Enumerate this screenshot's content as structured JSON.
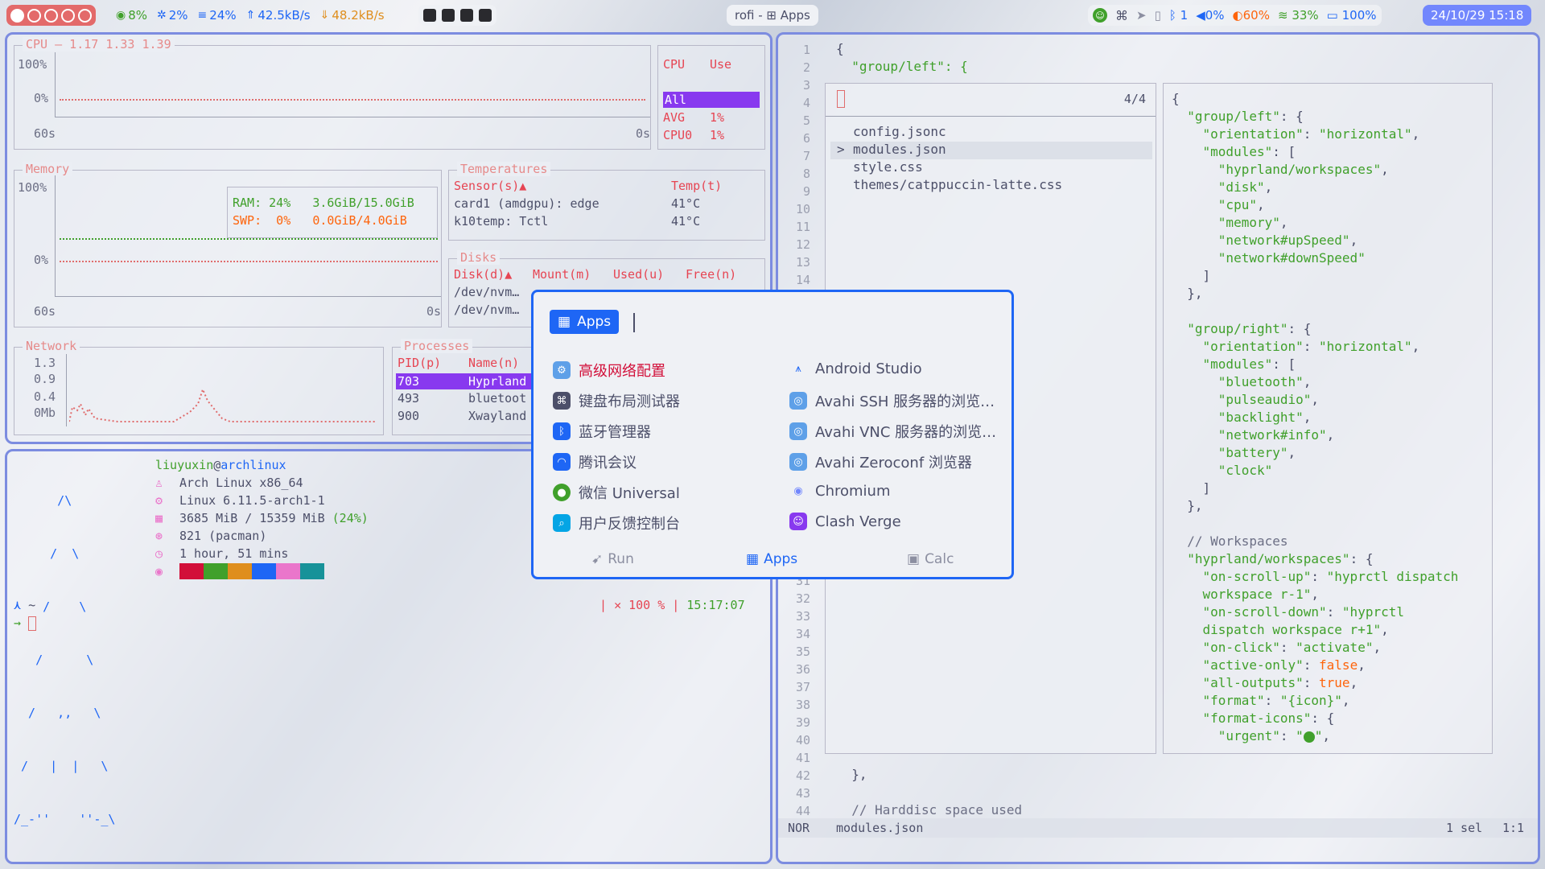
{
  "topbar": {
    "workspaces": [
      "1",
      "2",
      "3",
      "4",
      "5"
    ],
    "stats": [
      {
        "icon": "cpu-circle-icon",
        "value": "8%",
        "color": "#40a02b"
      },
      {
        "icon": "gear-icon",
        "value": "2%",
        "color": "#1e66f5"
      },
      {
        "icon": "memory-icon",
        "value": "24%",
        "color": "#1e66f5"
      },
      {
        "icon": "up-speed-icon",
        "value": "42.5kB/s",
        "color": "#1e66f5"
      },
      {
        "icon": "down-speed-icon",
        "value": "48.2kB/s",
        "color": "#df8e1d"
      }
    ],
    "window_title": "rofi - ⊞ Apps",
    "bluetooth": "1",
    "volume": "0%",
    "backlight": "60%",
    "wifi": "33%",
    "battery": "100%",
    "clock": "24/10/29 15:18"
  },
  "btop": {
    "cpu": {
      "title": "CPU — 1.17 1.33 1.39",
      "y_top": "100%",
      "y_bottom": "0%",
      "x_left": "60s",
      "x_right": "0s",
      "table_header": [
        "CPU",
        "Use"
      ],
      "rows": [
        {
          "name": "All",
          "use": ""
        },
        {
          "name": "AVG",
          "use": "1%"
        },
        {
          "name": "CPU0",
          "use": "1%"
        }
      ]
    },
    "memory": {
      "title": "Memory",
      "y_top": "100%",
      "y_bottom": "0%",
      "x_left": "60s",
      "x_right": "0s",
      "ram": "RAM: 24%   3.6GiB/15.0GiB",
      "swp": "SWP:  0%   0.0GiB/4.0GiB"
    },
    "temps": {
      "title": "Temperatures",
      "header_sensor": "Sensor(s)▲",
      "header_temp": "Temp(t)",
      "rows": [
        {
          "sensor": "card1 (amdgpu): edge",
          "temp": "41°C"
        },
        {
          "sensor": "k10temp: Tctl",
          "temp": "41°C"
        }
      ]
    },
    "disks": {
      "title": "Disks",
      "headers": [
        "Disk(d)▲",
        "Mount(m)",
        "Used(u)",
        "Free(n)"
      ],
      "rows": [
        "/dev/nvm…",
        "/dev/nvm…"
      ]
    },
    "network": {
      "title": "Network",
      "labels": [
        "1.3",
        "0.9",
        "0.4",
        "0Mb"
      ]
    },
    "processes": {
      "title": "Processes",
      "headers": [
        "PID(p)",
        "Name(n)"
      ],
      "rows": [
        {
          "pid": "703",
          "name": "Hyprland"
        },
        {
          "pid": "493",
          "name": "bluetoot"
        },
        {
          "pid": "900",
          "name": "Xwayland"
        }
      ]
    }
  },
  "fetch": {
    "user": "liuyuxin",
    "at": "@",
    "host": "archlinux",
    "lines": [
      {
        "icon": "arch-icon",
        "text": "Arch Linux x86_64"
      },
      {
        "icon": "kernel-gear-icon",
        "text": "Linux 6.11.5-arch1-1"
      },
      {
        "icon": "memory-chip-icon",
        "text": "3685 MiB / 15359 MiB ",
        "extra": "(24%)"
      },
      {
        "icon": "package-icon",
        "text": "821 (pacman)"
      },
      {
        "icon": "clock-icon",
        "text": "1 hour, 51 mins"
      }
    ],
    "palette": [
      "#d20f39",
      "#40a02b",
      "#df8e1d",
      "#1e66f5",
      "#ea76cb",
      "#179299"
    ],
    "ascii": [
      "      /\\",
      "     /  \\",
      "    /    \\",
      "   /      \\",
      "  /   ,,   \\",
      " /   |  |   \\",
      "/_-''    ''-_\\"
    ]
  },
  "shell": {
    "prompt_dir": "~",
    "status_x": "✕",
    "status_code": "100",
    "status_pct": "%",
    "time": "15:17:07"
  },
  "editor": {
    "lines_top": [
      "{",
      "  \"group/left\": {"
    ],
    "picker": {
      "count": "4/4",
      "items": [
        "config.jsonc",
        "modules.json",
        "style.css",
        "themes/catppuccin-latte.css"
      ],
      "selected_marker": ">"
    },
    "bottom_lines": [
      "  },",
      "",
      "  // Harddisc space used"
    ],
    "statusbar": {
      "mode": "NOR",
      "file": "modules.json",
      "sel": "1 sel",
      "pos": "1:1"
    }
  },
  "rofi": {
    "mode_label": "Apps",
    "apps_left": [
      {
        "label": "高级网络配置",
        "icon": "network-config-icon",
        "color": "#5ea0e8"
      },
      {
        "label": "键盘布局测试器",
        "icon": "keyboard-icon",
        "color": "#4c4f69"
      },
      {
        "label": "蓝牙管理器",
        "icon": "bluetooth-icon",
        "color": "#1e66f5"
      },
      {
        "label": "腾讯会议",
        "icon": "tencent-meeting-icon",
        "color": "#1e66f5"
      },
      {
        "label": "微信 Universal",
        "icon": "wechat-icon",
        "color": "#40a02b"
      },
      {
        "label": "用户反馈控制台",
        "icon": "feedback-icon",
        "color": "#04a5e5"
      }
    ],
    "apps_right": [
      {
        "label": "Android Studio",
        "icon": "android-studio-icon",
        "color": "#1e66f5"
      },
      {
        "label": "Avahi SSH 服务器的浏览…",
        "icon": "avahi-icon",
        "color": "#5ea0e8"
      },
      {
        "label": "Avahi VNC 服务器的浏览…",
        "icon": "avahi-icon",
        "color": "#5ea0e8"
      },
      {
        "label": "Avahi Zeroconf 浏览器",
        "icon": "avahi-icon",
        "color": "#5ea0e8"
      },
      {
        "label": "Chromium",
        "icon": "chromium-icon",
        "color": "#7287fd"
      },
      {
        "label": "Clash Verge",
        "icon": "clash-verge-icon",
        "color": "#8839ef"
      }
    ],
    "tabs": [
      "Run",
      "Apps",
      "Calc"
    ]
  }
}
